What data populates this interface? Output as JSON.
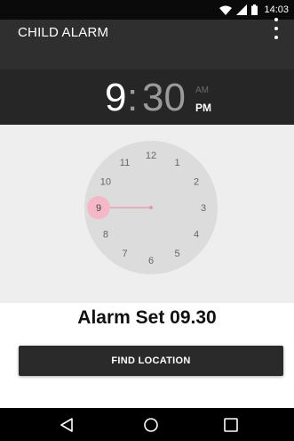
{
  "status_bar": {
    "time": "14:03",
    "icons": [
      "wifi-icon",
      "signal-icon",
      "battery-icon"
    ]
  },
  "app_bar": {
    "title": "CHILD ALARM",
    "menu_icon": "more-vert-icon"
  },
  "time_display": {
    "hour": "9",
    "separator": ":",
    "minutes": "30",
    "am_label": "AM",
    "pm_label": "PM",
    "selected_period": "PM"
  },
  "clock": {
    "numbers": [
      "12",
      "1",
      "2",
      "3",
      "4",
      "5",
      "6",
      "7",
      "8",
      "9",
      "10",
      "11"
    ],
    "selected_number": "9",
    "accent_color": "#f5b8c8",
    "hand_color": "#e895ad"
  },
  "alarm_status": "Alarm Set 09.30",
  "find_location_label": "FIND LOCATION",
  "nav_bar": {
    "icons": [
      "back-icon",
      "home-icon",
      "recents-icon"
    ]
  },
  "colors": {
    "status_bar": "#0a0a0a",
    "app_bar": "#2f2f2f",
    "time_header": "#262626",
    "clock_background": "#eeeeee",
    "clock_face": "#dcdcdc",
    "button": "#2a2a2a"
  }
}
